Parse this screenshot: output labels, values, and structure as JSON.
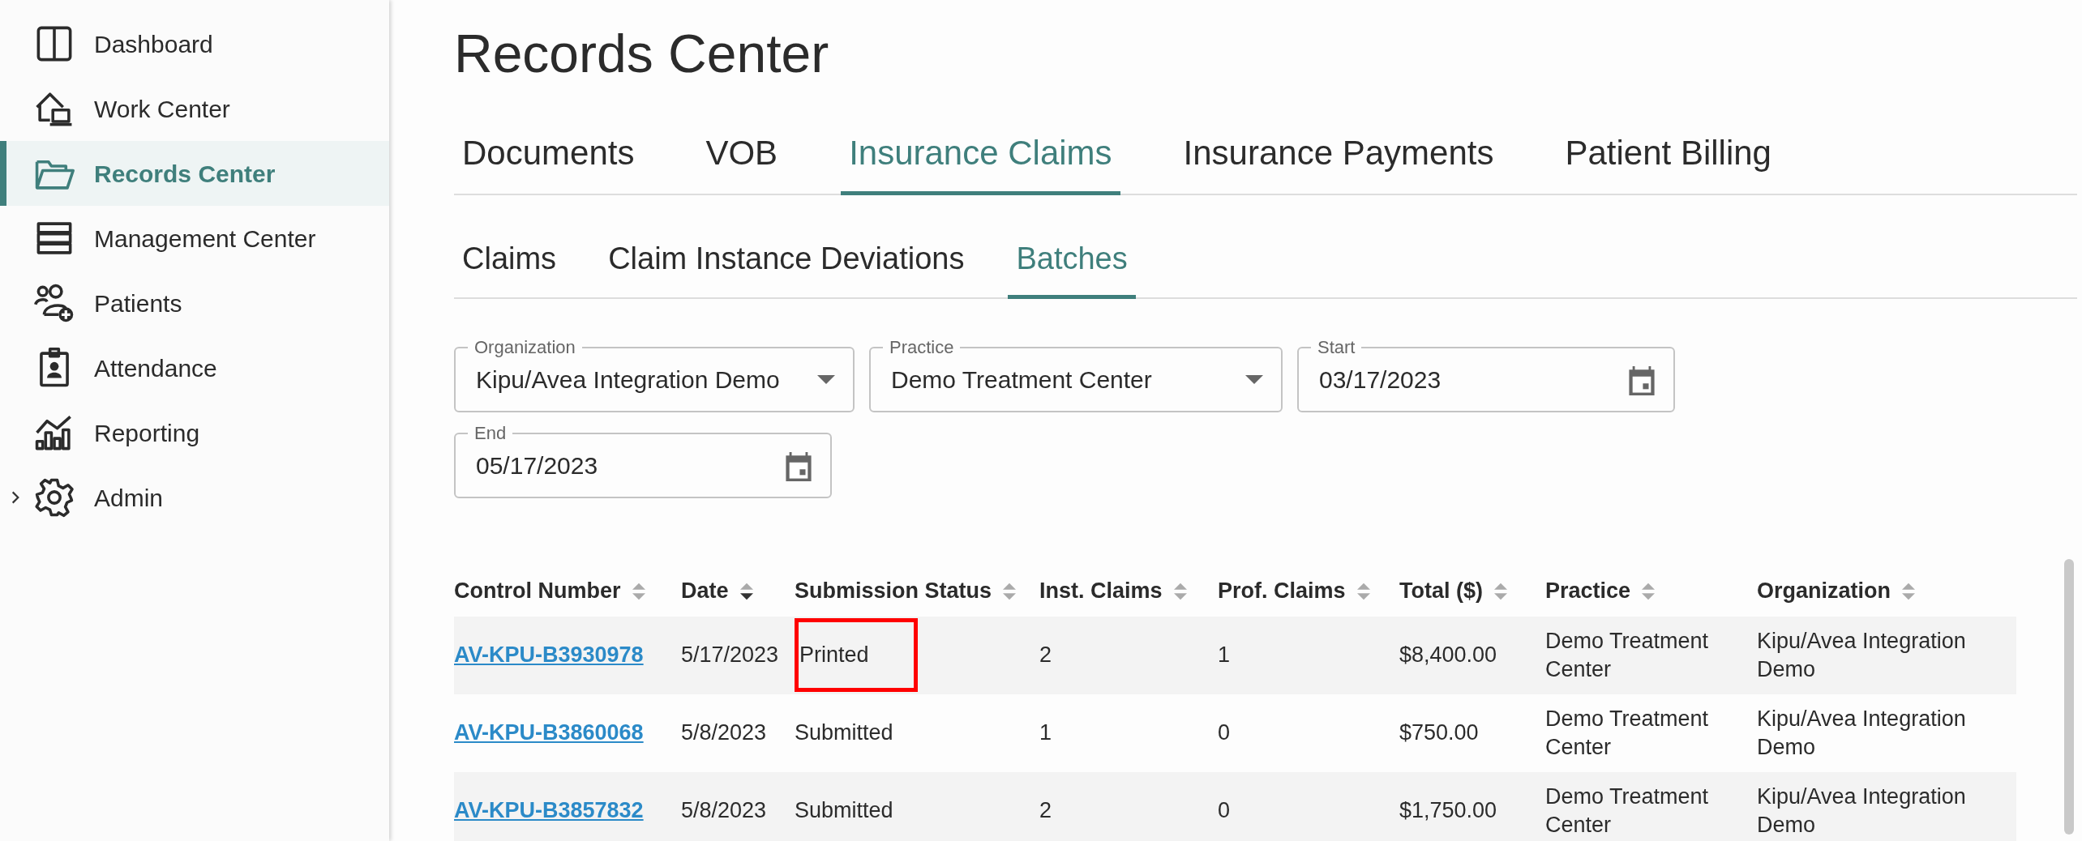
{
  "sidebar": {
    "items": [
      {
        "kind": "link",
        "label": "Dashboard",
        "selected": false
      },
      {
        "kind": "link",
        "label": "Work Center",
        "selected": false
      },
      {
        "kind": "link",
        "label": "Records Center",
        "selected": true
      },
      {
        "kind": "link",
        "label": "Management Center",
        "selected": false
      },
      {
        "kind": "link",
        "label": "Patients",
        "selected": false
      },
      {
        "kind": "link",
        "label": "Attendance",
        "selected": false
      },
      {
        "kind": "link",
        "label": "Reporting",
        "selected": false
      },
      {
        "kind": "group",
        "label": "Admin",
        "selected": false,
        "expanded": false
      }
    ]
  },
  "page_title": "Records Center",
  "tabs": [
    {
      "label": "Documents",
      "selected": false
    },
    {
      "label": "VOB",
      "selected": false
    },
    {
      "label": "Insurance Claims",
      "selected": true
    },
    {
      "label": "Insurance Payments",
      "selected": false
    },
    {
      "label": "Patient Billing",
      "selected": false
    }
  ],
  "subtabs": [
    {
      "label": "Claims",
      "selected": false
    },
    {
      "label": "Claim Instance Deviations",
      "selected": false
    },
    {
      "label": "Batches",
      "selected": true
    }
  ],
  "filters": [
    {
      "kind": "select",
      "label": "Organization",
      "value": "Kipu/Avea Integration Demo"
    },
    {
      "kind": "select",
      "label": "Practice",
      "value": "Demo Treatment Center"
    },
    {
      "kind": "date",
      "label": "Start",
      "value": "03/17/2023"
    },
    {
      "kind": "date",
      "label": "End",
      "value": "05/17/2023"
    }
  ],
  "table": {
    "columns": [
      {
        "label": "Control Number",
        "sorted": false
      },
      {
        "label": "Date",
        "sorted": true
      },
      {
        "label": "Submission Status",
        "sorted": false
      },
      {
        "label": "Inst. Claims",
        "sorted": false
      },
      {
        "label": "Prof. Claims",
        "sorted": false
      },
      {
        "label": "Total ($)",
        "sorted": false
      },
      {
        "label": "Practice",
        "sorted": false
      },
      {
        "label": "Organization",
        "sorted": false
      }
    ],
    "rows": [
      {
        "cells": [
          "AV-KPU-B3930978",
          "5/17/2023",
          "Printed",
          "2",
          "1",
          "$8,400.00",
          "Demo Treatment Center",
          "Kipu/Avea Integration Demo"
        ],
        "status_highlighted": true
      },
      {
        "cells": [
          "AV-KPU-B3860068",
          "5/8/2023",
          "Submitted",
          "1",
          "0",
          "$750.00",
          "Demo Treatment Center",
          "Kipu/Avea Integration Demo"
        ],
        "status_highlighted": false
      },
      {
        "cells": [
          "AV-KPU-B3857832",
          "5/8/2023",
          "Submitted",
          "2",
          "0",
          "$1,750.00",
          "Demo Treatment Center",
          "Kipu/Avea Integration Demo"
        ],
        "status_highlighted": false
      }
    ]
  }
}
